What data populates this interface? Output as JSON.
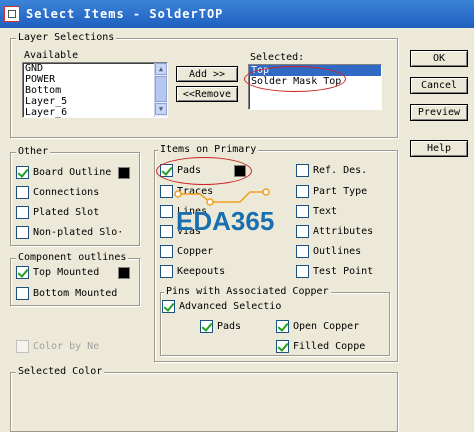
{
  "window": {
    "title": "Select Items - SolderTOP"
  },
  "layer_selections": {
    "label": "Layer Selections",
    "available_label": "Available",
    "available_items": [
      "GND",
      "POWER",
      "Bottom",
      "Layer_5",
      "Layer_6"
    ],
    "selected_label": "Selected:",
    "selected_items": [
      "Top",
      "Solder Mask Top"
    ],
    "add_button": "Add >>",
    "remove_button": "<<Remove"
  },
  "buttons": {
    "ok": "OK",
    "cancel": "Cancel",
    "preview": "Preview",
    "help": "Help"
  },
  "other": {
    "label": "Other",
    "items": [
      {
        "label": "Board Outline",
        "checked": true
      },
      {
        "label": "Connections",
        "checked": false
      },
      {
        "label": "Plated Slot",
        "checked": false
      },
      {
        "label": "Non-plated Slo·",
        "checked": false
      }
    ]
  },
  "component_outlines": {
    "label": "Component outlines",
    "items": [
      {
        "label": "Top Mounted",
        "checked": true
      },
      {
        "label": "Bottom Mounted",
        "checked": false
      }
    ]
  },
  "color_by_net": {
    "label": "Color by Ne",
    "enabled": false
  },
  "items_on_primary": {
    "label": "Items on Primary",
    "col1": [
      {
        "label": "Pads",
        "checked": true
      },
      {
        "label": "Traces",
        "checked": false
      },
      {
        "label": "Lines",
        "checked": false
      },
      {
        "label": "Vias",
        "checked": false
      },
      {
        "label": "Copper",
        "checked": false
      },
      {
        "label": "Keepouts",
        "checked": false
      }
    ],
    "col2": [
      {
        "label": "Ref. Des.",
        "checked": false
      },
      {
        "label": "Part Type",
        "checked": false
      },
      {
        "label": "Text",
        "checked": false
      },
      {
        "label": "Attributes",
        "checked": false
      },
      {
        "label": "Outlines",
        "checked": false
      },
      {
        "label": "Test Point",
        "checked": false
      }
    ]
  },
  "pins_copper": {
    "label": "Pins with Associated Copper",
    "advanced": "Advanced Selectio",
    "pads": "Pads",
    "open_copper": "Open Copper",
    "filled_copper": "Filled Coppe"
  },
  "selected_color": {
    "label": "Selected Color"
  },
  "watermark": {
    "text": "EDA365"
  },
  "colors": {
    "swatch": "#000000",
    "annotation": "#cc2222",
    "watermark": "#1a6fb0",
    "watermark_accent": "#f0a020"
  }
}
